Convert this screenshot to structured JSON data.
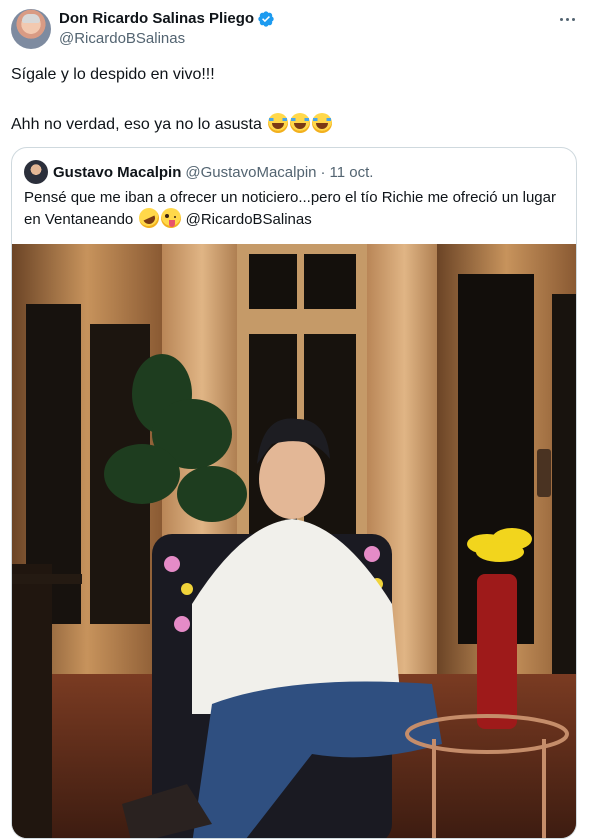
{
  "tweet": {
    "author": {
      "display_name": "Don Ricardo Salinas Pliego",
      "handle": "@RicardoBSalinas",
      "verified": true,
      "verified_color": "#1d9bf0"
    },
    "text_line1": "Sígale y lo despido en vivo!!!",
    "text_line2": "Ahh no verdad, eso ya no lo asusta",
    "text_line2_emojis": [
      "face-with-tears-of-joy",
      "face-with-tears-of-joy",
      "face-with-tears-of-joy"
    ],
    "more_icon": "more-horizontal-icon"
  },
  "quoted": {
    "display_name": "Gustavo Macalpin",
    "handle": "@GustavoMacalpin",
    "separator": "·",
    "time": "11 oct.",
    "text_line1": "Pensé que me iban a ofrecer un noticiero...pero el tío Richie me ofreció un lugar",
    "text_line2_start": "en Ventaneando",
    "text_line2_emojis": [
      "rolling-on-the-floor-laughing",
      "winking-face-with-tongue"
    ],
    "mention": "@RicardoBSalinas",
    "photo": "man in white shirt and jeans seated in floral armchair in wood-paneled studio"
  },
  "colors": {
    "text": "#0f1419",
    "secondary": "#536471",
    "border": "#cfd9de"
  }
}
